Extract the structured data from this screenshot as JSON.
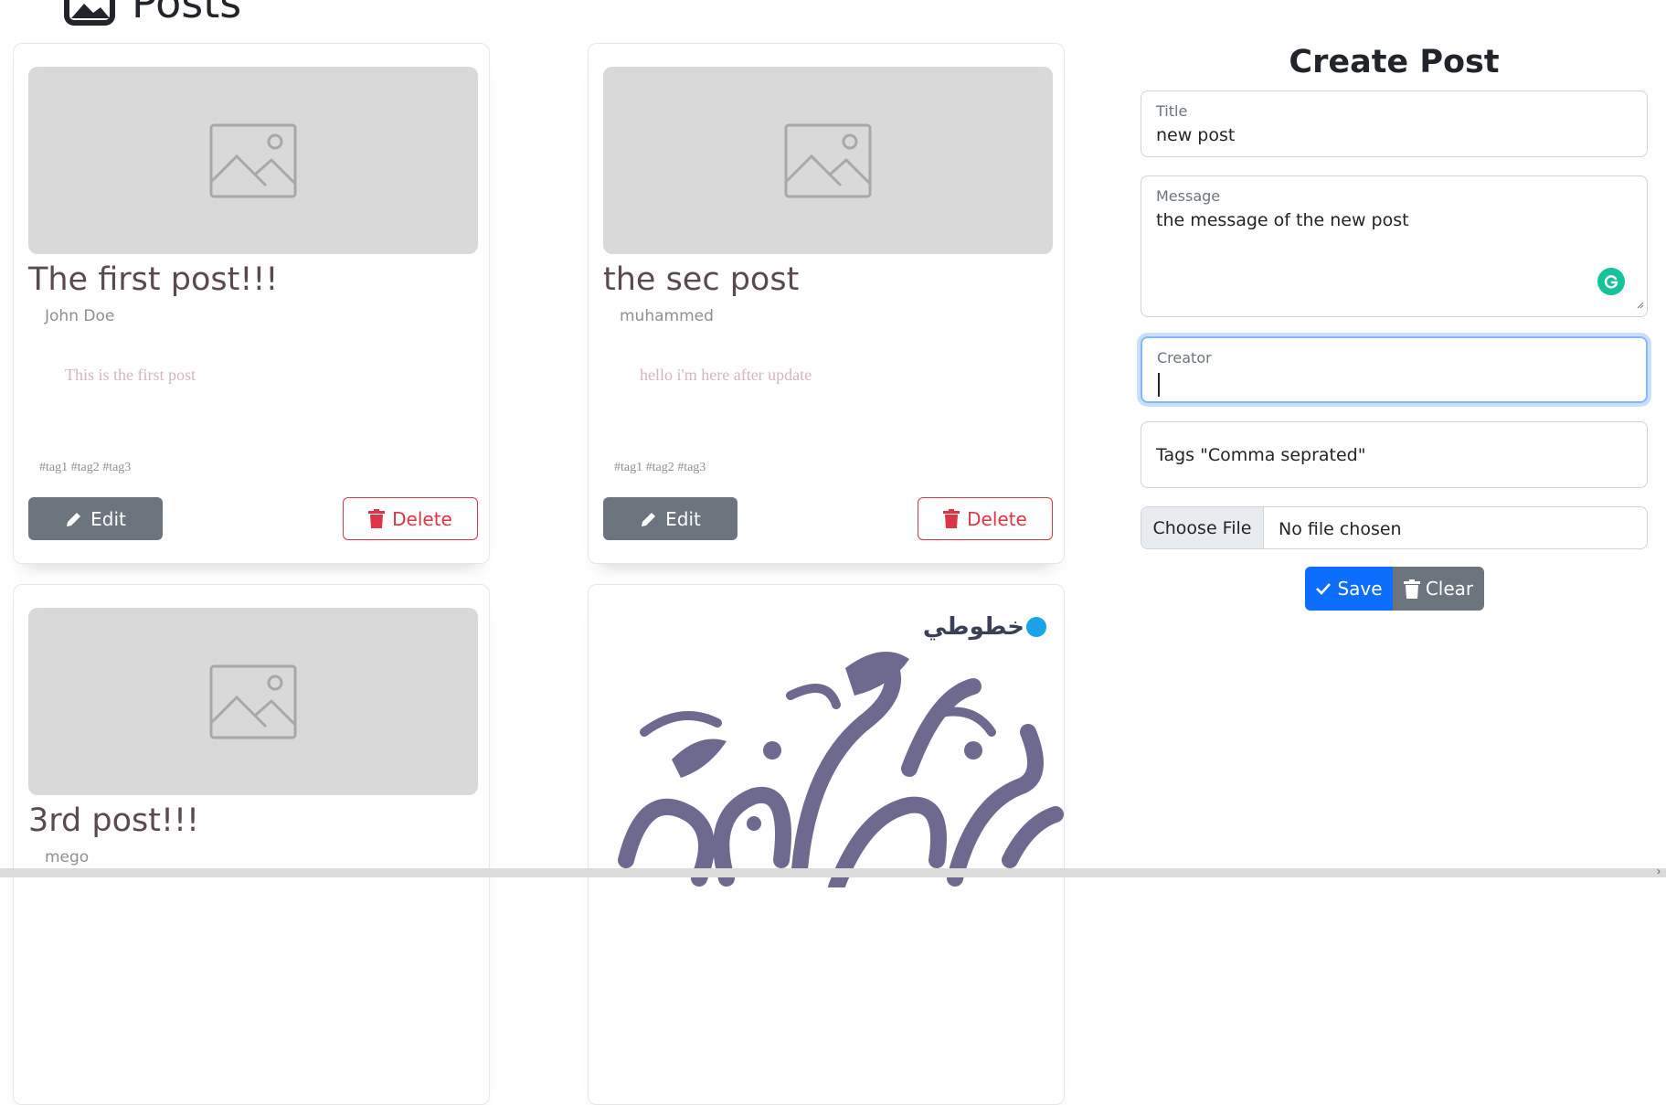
{
  "header": {
    "title": "Posts",
    "icon": "images-icon"
  },
  "posts": [
    {
      "title": "The first post!!!",
      "creator": "John Doe",
      "message": "This is the first post",
      "tags": "#tag1 #tag2 #tag3",
      "edit_label": "Edit",
      "delete_label": "Delete",
      "image": "placeholder-image"
    },
    {
      "title": "the sec post",
      "creator": "muhammed",
      "message": "hello i'm here after update",
      "tags": "#tag1 #tag2 #tag3",
      "edit_label": "Edit",
      "delete_label": "Delete",
      "image": "placeholder-image"
    },
    {
      "title": "3rd post!!!",
      "creator": "mego",
      "image": "placeholder-image"
    },
    {
      "image": "arabic-calligraphy-image",
      "logo_text": "خطوطي"
    }
  ],
  "form": {
    "title": "Create Post",
    "title_field": {
      "label": "Title",
      "value": "new post"
    },
    "message_field": {
      "label": "Message",
      "value": "the message of the new post"
    },
    "creator_field": {
      "label": "Creator",
      "value": ""
    },
    "tags_field": {
      "placeholder": "Tags \"Comma seprated\""
    },
    "file_field": {
      "button_label": "Choose File",
      "status": "No file chosen"
    },
    "save_label": "Save",
    "clear_label": "Clear"
  },
  "colors": {
    "primary": "#0d6efd",
    "secondary": "#6c757d",
    "danger": "#dc3545",
    "placeholder_bg": "#d9d9d9",
    "calligraphy": "#6e6a8f",
    "grammarly": "#15c39a"
  }
}
